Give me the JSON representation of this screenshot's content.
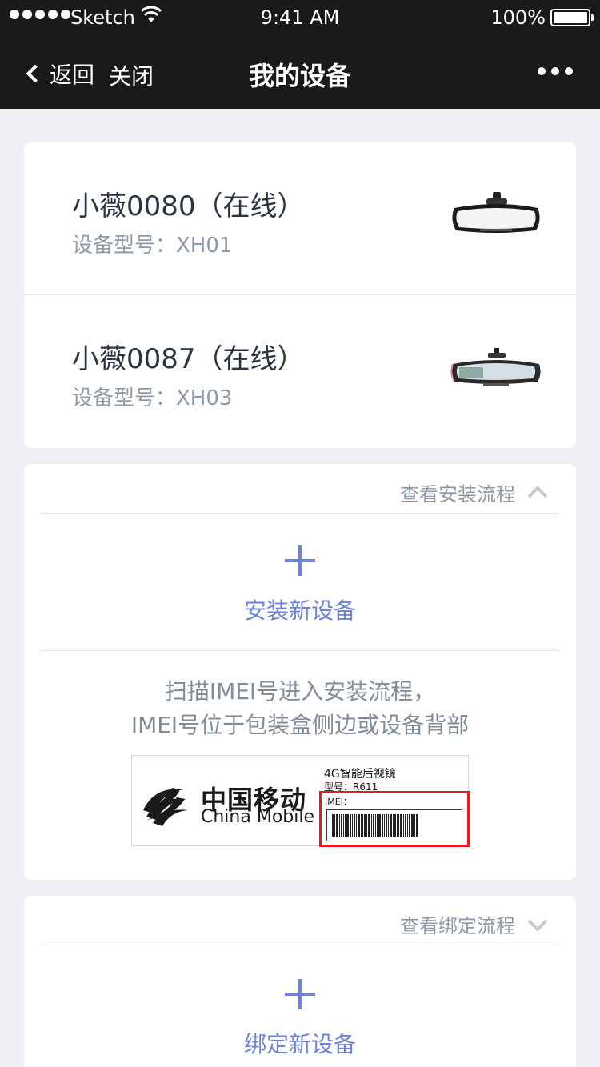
{
  "status_bar": {
    "carrier": "Sketch",
    "time": "9:41 AM",
    "battery": "100%"
  },
  "nav": {
    "back_label": "返回",
    "close_label": "关闭",
    "title": "我的设备"
  },
  "devices": [
    {
      "name": "小薇0080（在线）",
      "model": "设备型号：XH01"
    },
    {
      "name": "小薇0087（在线）",
      "model": "设备型号：XH03"
    }
  ],
  "install": {
    "link_label": "查看安装流程",
    "add_label": "安装新设备",
    "hint_line1": "扫描IMEI号进入安装流程，",
    "hint_line2": "IMEI号位于包装盒侧边或设备背部",
    "sample_label": {
      "brand_cn": "中国移动",
      "brand_en": "China Mobile",
      "product": "4G智能后视镜",
      "model": "型号：R611",
      "imei": "IMEI："
    }
  },
  "bind": {
    "link_label": "查看绑定流程",
    "add_label": "绑定新设备"
  },
  "colors": {
    "nav_bg": "#1a1a1a",
    "accent": "#6d84d6",
    "page_bg": "#efeff4",
    "highlight": "#e02020"
  }
}
